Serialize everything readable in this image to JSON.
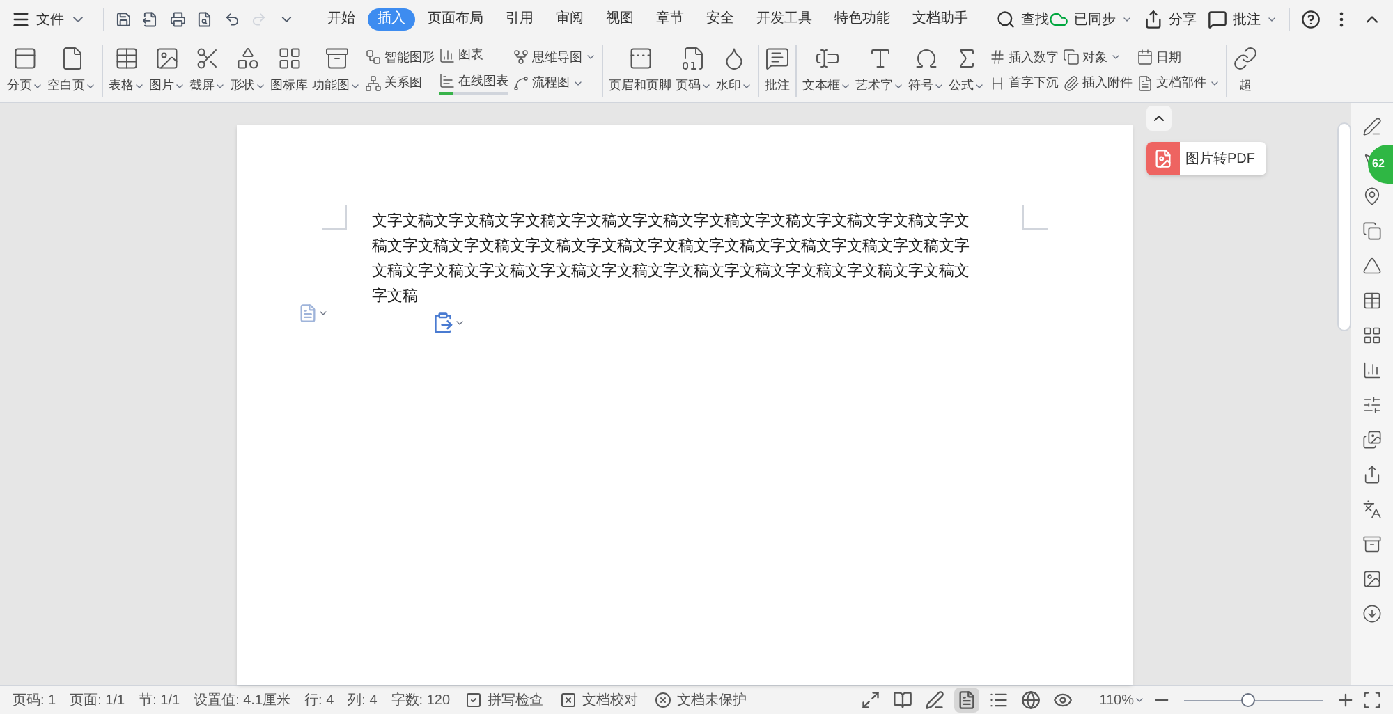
{
  "menu": {
    "file": "文件",
    "tabs": [
      {
        "label": "开始",
        "selected": false
      },
      {
        "label": "插入",
        "selected": true
      },
      {
        "label": "页面布局",
        "selected": false
      },
      {
        "label": "引用",
        "selected": false
      },
      {
        "label": "审阅",
        "selected": false
      },
      {
        "label": "视图",
        "selected": false
      },
      {
        "label": "章节",
        "selected": false
      },
      {
        "label": "安全",
        "selected": false
      },
      {
        "label": "开发工具",
        "selected": false
      },
      {
        "label": "特色功能",
        "selected": false
      },
      {
        "label": "文档助手",
        "selected": false
      }
    ],
    "search": "查找",
    "sync": "已同步",
    "share": "分享",
    "comment": "批注"
  },
  "ribbon": [
    [
      {
        "kind": "large",
        "label": "分页",
        "dropdown": true
      },
      {
        "kind": "large",
        "label": "空白页",
        "dropdown": true
      }
    ],
    [
      {
        "kind": "large",
        "label": "表格",
        "dropdown": true
      },
      {
        "kind": "large",
        "label": "图片",
        "dropdown": true
      },
      {
        "kind": "large",
        "label": "截屏",
        "dropdown": true
      },
      {
        "kind": "large",
        "label": "形状",
        "dropdown": true
      },
      {
        "kind": "large",
        "label": "图标库",
        "dropdown": false
      },
      {
        "kind": "large",
        "label": "功能图",
        "dropdown": true
      },
      {
        "kind": "stack",
        "items": [
          {
            "label": "智能图形",
            "dropdown": false
          },
          {
            "label": "关系图",
            "dropdown": false
          }
        ]
      },
      {
        "kind": "stack",
        "items": [
          {
            "label": "图表",
            "dropdown": false
          },
          {
            "label": "在线图表",
            "dropdown": false,
            "level": 0.2
          }
        ]
      },
      {
        "kind": "stack",
        "items": [
          {
            "label": "思维导图",
            "dropdown": true
          },
          {
            "label": "流程图",
            "dropdown": true
          }
        ]
      }
    ],
    [
      {
        "kind": "large",
        "label": "页眉和页脚",
        "dropdown": false
      },
      {
        "kind": "large",
        "label": "页码",
        "dropdown": true
      },
      {
        "kind": "large",
        "label": "水印",
        "dropdown": true
      }
    ],
    [
      {
        "kind": "large",
        "label": "批注",
        "dropdown": false
      }
    ],
    [
      {
        "kind": "large",
        "label": "文本框",
        "dropdown": true
      },
      {
        "kind": "large",
        "label": "艺术字",
        "dropdown": true
      },
      {
        "kind": "large",
        "label": "符号",
        "dropdown": true
      },
      {
        "kind": "large",
        "label": "公式",
        "dropdown": true
      },
      {
        "kind": "stack",
        "items": [
          {
            "label": "插入数字",
            "dropdown": false
          },
          {
            "label": "首字下沉",
            "dropdown": false
          }
        ]
      },
      {
        "kind": "stack",
        "items": [
          {
            "label": "对象",
            "dropdown": true
          },
          {
            "label": "插入附件",
            "dropdown": false
          }
        ]
      },
      {
        "kind": "stack",
        "items": [
          {
            "label": "日期",
            "dropdown": false
          },
          {
            "label": "文档部件",
            "dropdown": true
          }
        ]
      }
    ],
    [
      {
        "kind": "large",
        "label": "超",
        "dropdown": false
      }
    ]
  ],
  "document": {
    "text": "文字文稿文字文稿文字文稿文字文稿文字文稿文字文稿文字文稿文字文稿文字文稿文字文稿文字文稿文字文稿文字文稿文字文稿文字文稿文字文稿文字文稿文字文稿文字文稿文字文稿文字文稿文字文稿文字文稿文字文稿文字文稿文字文稿文字文稿文字文稿文字文稿文字文稿"
  },
  "float_panel": {
    "label": "图片转PDF"
  },
  "badge": "62",
  "status_bar": {
    "fields": [
      "页码: 1",
      "页面: 1/1",
      "节: 1/1",
      "设置值: 4.1厘米",
      "行: 4",
      "列: 4",
      "字数: 120"
    ],
    "buttons": [
      "拼写检查",
      "文档校对",
      "文档未保护"
    ],
    "views": [
      {
        "selected": false
      },
      {
        "selected": false
      },
      {
        "selected": false
      },
      {
        "selected": true
      },
      {
        "selected": false
      },
      {
        "selected": false
      },
      {
        "selected": false
      }
    ],
    "zoom": "110%",
    "zoom_level": {
      "level": 0.45
    }
  }
}
